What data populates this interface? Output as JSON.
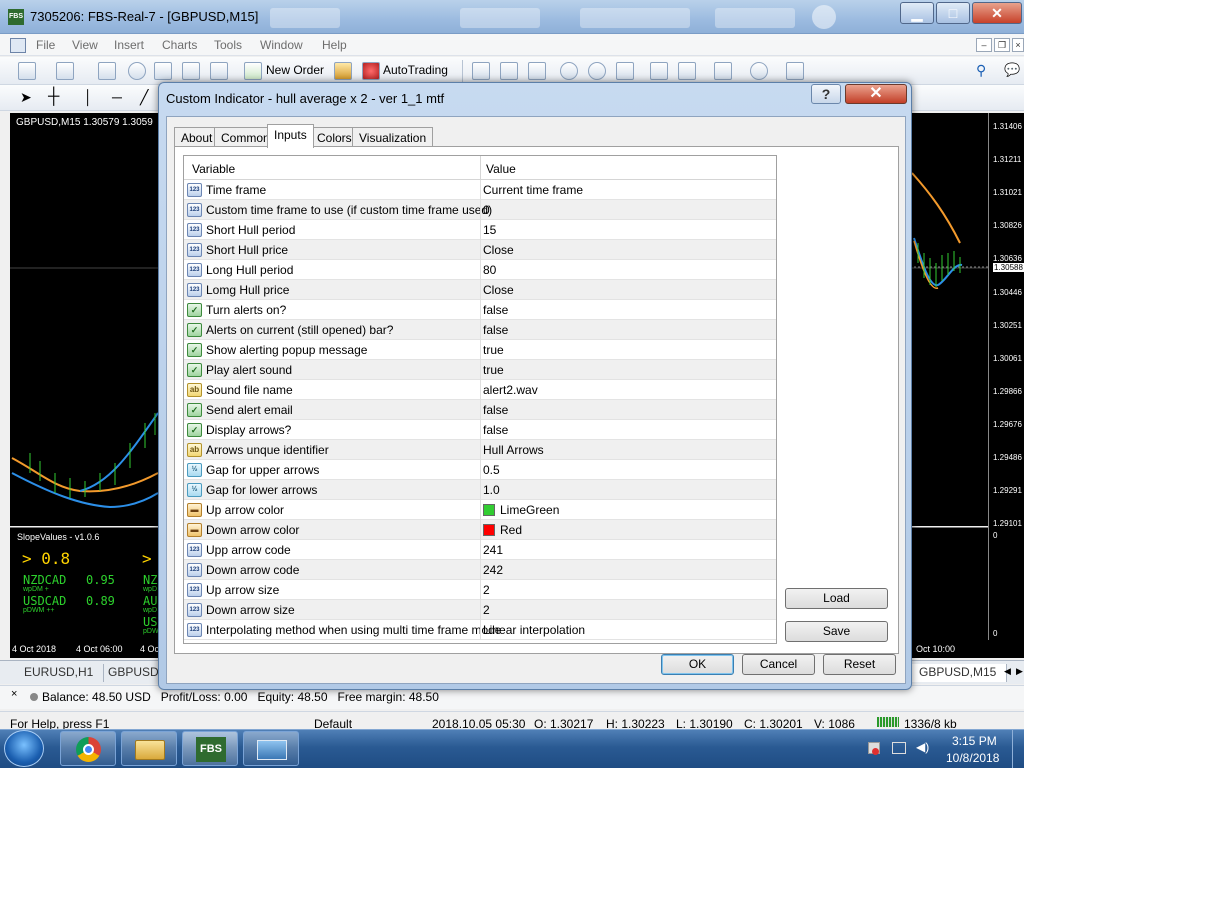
{
  "window": {
    "title": "7305206: FBS-Real-7 - [GBPUSD,M15]",
    "logo_text": "FBS",
    "minimize": "▁",
    "maximize": "□",
    "close": "✕"
  },
  "menu": [
    "File",
    "View",
    "Insert",
    "Charts",
    "Tools",
    "Window",
    "Help"
  ],
  "toolbar": {
    "new_order": "New Order",
    "autotrading": "AutoTrading"
  },
  "chart": {
    "header": "GBPUSD,M15  1.30579 1.3059",
    "prices": [
      "1.31406",
      "1.31211",
      "1.31021",
      "1.30826",
      "1.30636",
      "1.30588",
      "1.30446",
      "1.30251",
      "1.30061",
      "1.29866",
      "1.29676",
      "1.29486",
      "1.29291",
      "1.29101"
    ],
    "indicator_axis": [
      "0",
      "0"
    ],
    "time_labels": [
      "4 Oct 2018",
      "4 Oct 06:00",
      "4 Oc",
      "Oct 10:00"
    ],
    "slope": {
      "title": "SlopeValues - v1.0.6",
      "value": "> 0.8",
      "value2": ">",
      "rows": [
        {
          "pair": "NZDCAD",
          "val": "0.95",
          "sub": "wpDM +",
          "right": "NZ",
          "rsub": "wpD"
        },
        {
          "pair": "USDCAD",
          "val": "0.89",
          "sub": "pDWM ++",
          "right": "AU",
          "rsub": "wpD"
        }
      ],
      "extra": "US",
      "extra_sub": "pDW"
    }
  },
  "tabs_bottom": [
    "EURUSD,H1",
    "GBPUSD",
    "GBPUSD,M15"
  ],
  "balance": {
    "text": "Balance: 48.50 USD   Profit/Loss: 0.00   Equity: 48.50   Free margin: 48.50"
  },
  "status": {
    "help": "For Help, press F1",
    "profile": "Default",
    "datetime": "2018.10.05 05:30",
    "open": "O: 1.30217",
    "high": "H: 1.30223",
    "low": "L: 1.30190",
    "close": "C: 1.30201",
    "volume": "V: 1086",
    "traffic": "1336/8 kb"
  },
  "taskbar": {
    "fbs": "FBS",
    "time": "3:15 PM",
    "date": "10/8/2018"
  },
  "dialog": {
    "title": "Custom Indicator - hull average x 2 - ver 1_1 mtf",
    "help": "?",
    "close": "✕",
    "tabs": [
      "About",
      "Common",
      "Inputs",
      "Colors",
      "Visualization"
    ],
    "active_tab": "Inputs",
    "columns": {
      "variable": "Variable",
      "value": "Value"
    },
    "rows": [
      {
        "type": "123",
        "var": "Time frame",
        "val": "Current time frame"
      },
      {
        "type": "123",
        "var": "Custom time frame to use (if custom time frame used)",
        "val": "0"
      },
      {
        "type": "123",
        "var": "Short Hull period",
        "val": "15"
      },
      {
        "type": "123",
        "var": "Short Hull price",
        "val": "Close"
      },
      {
        "type": "123",
        "var": "Long Hull period",
        "val": "80"
      },
      {
        "type": "123",
        "var": "Lomg Hull price",
        "val": "Close"
      },
      {
        "type": "bool",
        "var": "Turn alerts on?",
        "val": "false"
      },
      {
        "type": "bool",
        "var": "Alerts on current (still opened) bar?",
        "val": "false"
      },
      {
        "type": "bool",
        "var": "Show alerting popup message",
        "val": "true"
      },
      {
        "type": "bool",
        "var": "Play alert sound",
        "val": "true"
      },
      {
        "type": "ab",
        "var": "Sound file name",
        "val": "alert2.wav"
      },
      {
        "type": "bool",
        "var": "Send alert email",
        "val": "false"
      },
      {
        "type": "bool",
        "var": "Display arrows?",
        "val": "false"
      },
      {
        "type": "ab",
        "var": "Arrows unque identifier",
        "val": "Hull Arrows"
      },
      {
        "type": "dbl",
        "var": "Gap for upper arrows",
        "val": "0.5"
      },
      {
        "type": "dbl",
        "var": "Gap for lower arrows",
        "val": "1.0"
      },
      {
        "type": "clr",
        "var": "Up arrow color",
        "val": "LimeGreen",
        "color": "#32cd32"
      },
      {
        "type": "clr",
        "var": "Down arrow color",
        "val": "Red",
        "color": "#ff0000"
      },
      {
        "type": "123",
        "var": "Upp arrow code",
        "val": "241"
      },
      {
        "type": "123",
        "var": "Down arrow code",
        "val": "242"
      },
      {
        "type": "123",
        "var": "Up arrow size",
        "val": "2"
      },
      {
        "type": "123",
        "var": "Down arrow size",
        "val": "2"
      },
      {
        "type": "123",
        "var": "Interpolating method when using multi time frame mode",
        "val": "Linear interpolation"
      }
    ],
    "buttons": {
      "load": "Load",
      "save": "Save",
      "ok": "OK",
      "cancel": "Cancel",
      "reset": "Reset"
    }
  }
}
